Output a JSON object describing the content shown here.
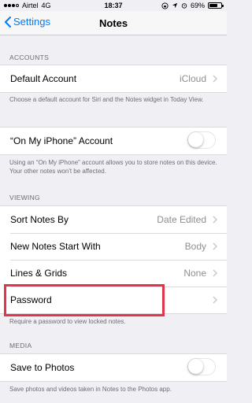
{
  "status_bar": {
    "carrier": "Airtel",
    "network": "4G",
    "time": "18:37",
    "battery_percent": "69%",
    "battery_level": 0.69
  },
  "nav": {
    "back_label": "Settings",
    "title": "Notes"
  },
  "sections": {
    "accounts": {
      "header": "ACCOUNTS",
      "default_account_label": "Default Account",
      "default_account_value": "iCloud",
      "footer": "Choose a default account for Siri and the Notes widget in Today View."
    },
    "on_my_iphone": {
      "label": "“On My iPhone” Account",
      "enabled": false,
      "footer": "Using an “On My iPhone” account allows you to store notes on this device. Your other notes won't be affected."
    },
    "viewing": {
      "header": "VIEWING",
      "rows": [
        {
          "label": "Sort Notes By",
          "value": "Date Edited"
        },
        {
          "label": "New Notes Start With",
          "value": "Body"
        },
        {
          "label": "Lines & Grids",
          "value": "None"
        },
        {
          "label": "Password",
          "value": ""
        }
      ],
      "footer": "Require a password to view locked notes."
    },
    "media": {
      "header": "MEDIA",
      "save_to_photos_label": "Save to Photos",
      "enabled": false,
      "footer": "Save photos and videos taken in Notes to the Photos app."
    }
  },
  "colors": {
    "accent": "#007aff",
    "highlight": "#e0354a",
    "background": "#efeff4"
  }
}
